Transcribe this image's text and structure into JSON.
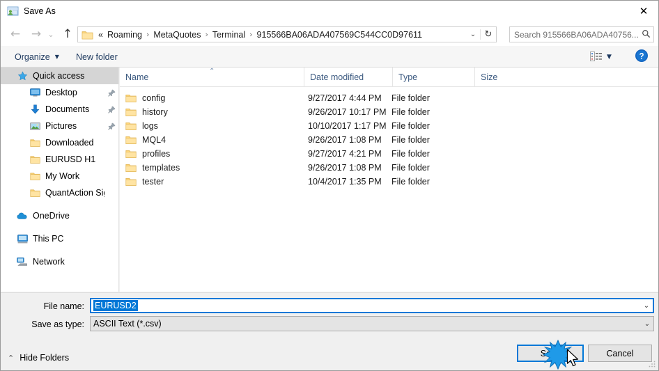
{
  "window": {
    "title": "Save As",
    "icon": "save-as-icon",
    "close_label": "✕"
  },
  "nav": {
    "back": "←",
    "forward": "→",
    "recent": "⌄",
    "up": "↑",
    "refresh": "↻",
    "dropdown": "⌄"
  },
  "address": {
    "folder_icon": "folder-icon",
    "lead": "«",
    "separator": "›",
    "crumbs": [
      "Roaming",
      "MetaQuotes",
      "Terminal",
      "915566BA06ADA407569C544CC0D97611"
    ]
  },
  "search": {
    "placeholder": "Search 915566BA06ADA40756...",
    "icon": "search-icon"
  },
  "toolbar": {
    "organize_label": "Organize",
    "organize_caret": "▼",
    "new_folder_label": "New folder",
    "view_icon": "details-view-icon",
    "view_caret": "▼",
    "help_label": "?"
  },
  "sidebar": {
    "items": [
      {
        "label": "Quick access",
        "icon": "star-icon",
        "indent": 0,
        "selected": true,
        "pinned": false
      },
      {
        "label": "Desktop",
        "icon": "monitor-icon",
        "indent": 1,
        "selected": false,
        "pinned": true
      },
      {
        "label": "Documents",
        "icon": "download-arrow-icon",
        "indent": 1,
        "selected": false,
        "pinned": true
      },
      {
        "label": "Pictures",
        "icon": "picture-icon",
        "indent": 1,
        "selected": false,
        "pinned": true
      },
      {
        "label": "Downloaded",
        "icon": "folder-icon",
        "indent": 1,
        "selected": false,
        "pinned": false
      },
      {
        "label": "EURUSD H1",
        "icon": "folder-icon",
        "indent": 1,
        "selected": false,
        "pinned": false
      },
      {
        "label": "My Work",
        "icon": "folder-icon",
        "indent": 1,
        "selected": false,
        "pinned": false
      },
      {
        "label": "QuantAction Signal",
        "icon": "folder-icon",
        "indent": 1,
        "selected": false,
        "pinned": false
      },
      {
        "label": "OneDrive",
        "icon": "cloud-icon",
        "indent": 0,
        "selected": false,
        "pinned": false,
        "gap_before": true
      },
      {
        "label": "This PC",
        "icon": "this-pc-icon",
        "indent": 0,
        "selected": false,
        "pinned": false,
        "gap_before": true
      },
      {
        "label": "Network",
        "icon": "network-icon",
        "indent": 0,
        "selected": false,
        "pinned": false,
        "gap_before": true
      }
    ]
  },
  "filelist": {
    "columns": [
      {
        "label": "Name",
        "sorted": "asc",
        "sort_caret": "⌃"
      },
      {
        "label": "Date modified",
        "sorted": ""
      },
      {
        "label": "Type",
        "sorted": ""
      },
      {
        "label": "Size",
        "sorted": ""
      }
    ],
    "rows": [
      {
        "name": "config",
        "date": "9/27/2017 4:44 PM",
        "type": "File folder",
        "size": "",
        "icon": "folder-icon"
      },
      {
        "name": "history",
        "date": "9/26/2017 10:17 PM",
        "type": "File folder",
        "size": "",
        "icon": "folder-icon"
      },
      {
        "name": "logs",
        "date": "10/10/2017 1:17 PM",
        "type": "File folder",
        "size": "",
        "icon": "folder-icon"
      },
      {
        "name": "MQL4",
        "date": "9/26/2017 1:08 PM",
        "type": "File folder",
        "size": "",
        "icon": "folder-icon"
      },
      {
        "name": "profiles",
        "date": "9/27/2017 4:21 PM",
        "type": "File folder",
        "size": "",
        "icon": "folder-icon"
      },
      {
        "name": "templates",
        "date": "9/26/2017 1:08 PM",
        "type": "File folder",
        "size": "",
        "icon": "folder-icon"
      },
      {
        "name": "tester",
        "date": "10/4/2017 1:35 PM",
        "type": "File folder",
        "size": "",
        "icon": "folder-icon"
      }
    ]
  },
  "form": {
    "filename_label": "File name:",
    "filename_value": "EURUSD2",
    "filetype_label": "Save as type:",
    "filetype_value": "ASCII Text (*.csv)",
    "dropdown_caret": "⌄",
    "hide_folders_label": "Hide Folders",
    "hide_folders_caret": "⌃",
    "save_label": "Save",
    "cancel_label": "Cancel"
  },
  "colors": {
    "accent": "#0078d7",
    "selection_text_bg": "#0078d7",
    "sidebar_selected_bg": "#d5d5d5",
    "dialog_bg": "#f0f0f0",
    "folder_yellow": "#ffd77a"
  }
}
